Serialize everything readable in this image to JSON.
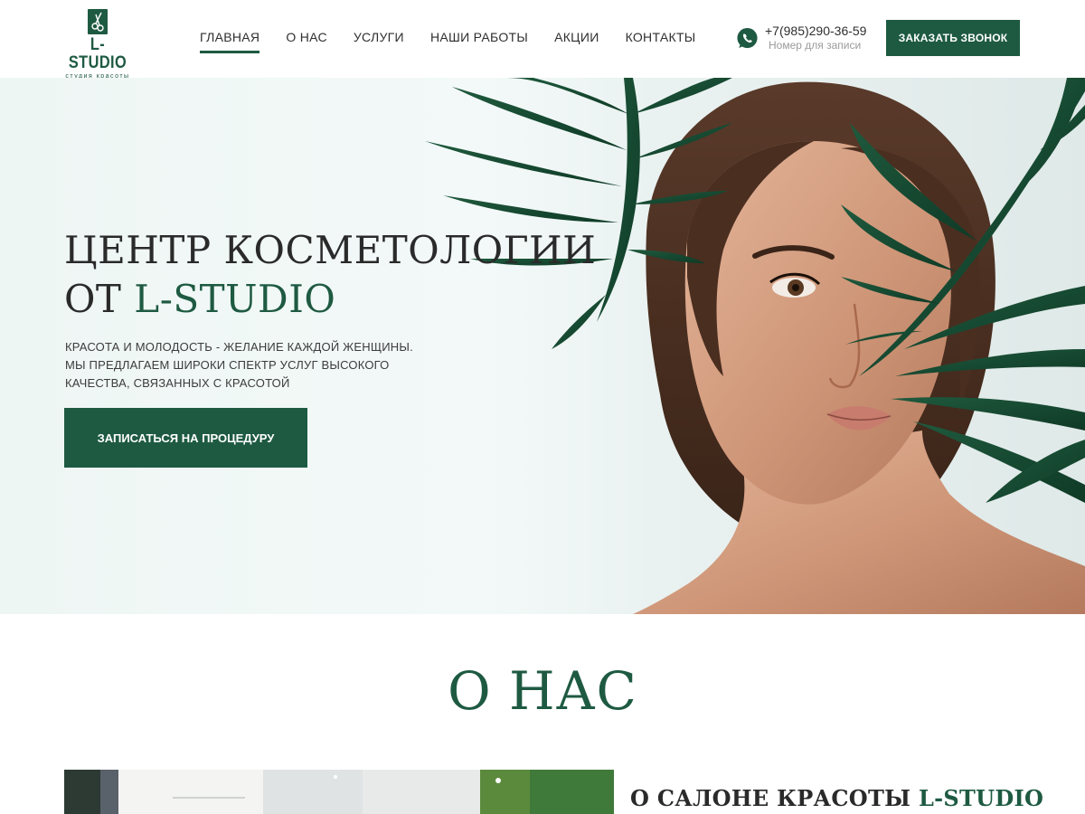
{
  "brand": {
    "name": "L-STUDIO",
    "tagline": "студия красоты",
    "color": "#1e5a42"
  },
  "nav": {
    "items": [
      {
        "label": "ГЛАВНАЯ",
        "active": true
      },
      {
        "label": "О НАС",
        "active": false
      },
      {
        "label": "УСЛУГИ",
        "active": false
      },
      {
        "label": "НАШИ РАБОТЫ",
        "active": false
      },
      {
        "label": "АКЦИИ",
        "active": false
      },
      {
        "label": "КОНТАКТЫ",
        "active": false
      }
    ]
  },
  "contact": {
    "icon": "whatsapp-icon",
    "phone": "+7(985)290-36-59",
    "note": "Номер для записи"
  },
  "header": {
    "call_button": "ЗАКАЗАТЬ ЗВОНОК"
  },
  "hero": {
    "title_line1": "ЦЕНТР КОСМЕТОЛОГИИ",
    "title_line2_prefix": "ОТ ",
    "title_line2_accent": "L-STUDIO",
    "text_lines": [
      "КРАСОТА И МОЛОДОСТЬ - ЖЕЛАНИЕ КАЖДОЙ ЖЕНЩИНЫ.",
      "МЫ ПРЕДЛАГАЕМ ШИРОКИ СПЕКТР УСЛУГ ВЫСОКОГО",
      "КАЧЕСТВА, СВЯЗАННЫХ С КРАСОТОЙ"
    ],
    "button": "ЗАПИСАТЬСЯ НА ПРОЦЕДУРУ"
  },
  "about": {
    "title": "О НАС",
    "subtitle_prefix": "О САЛОНЕ КРАСОТЫ ",
    "subtitle_accent": "L-STUDIO"
  }
}
